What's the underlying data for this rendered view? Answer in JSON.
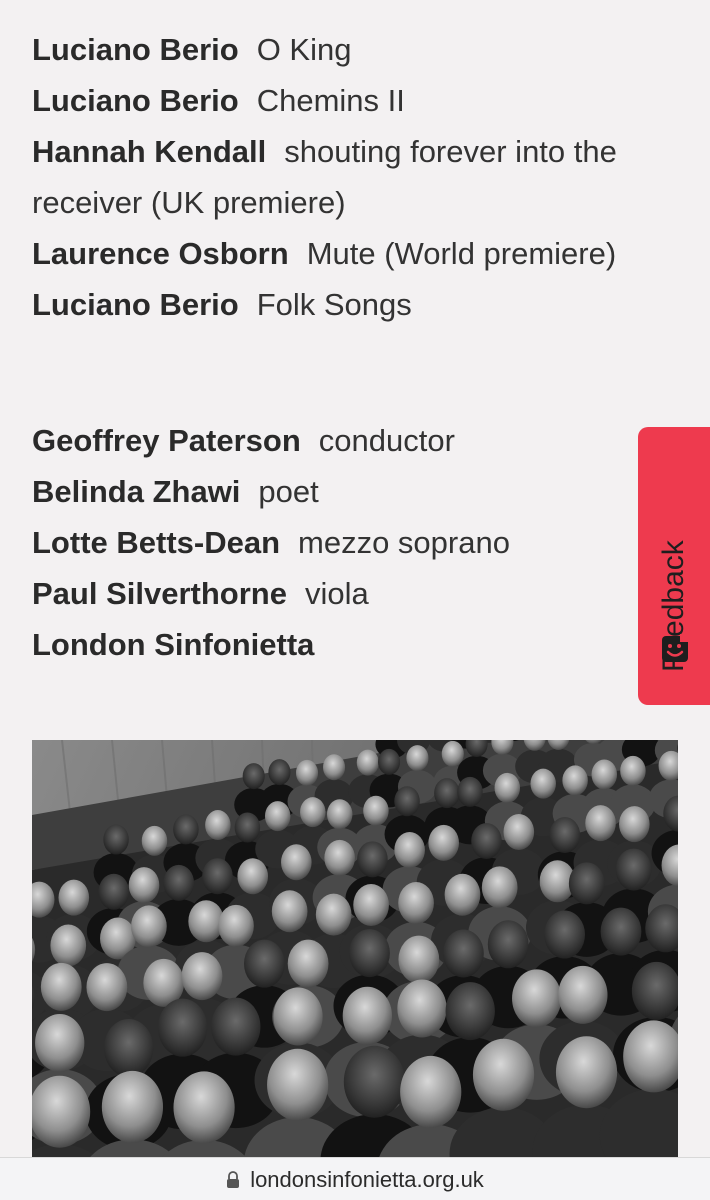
{
  "program": [
    {
      "composer": "Luciano Berio",
      "work": "O King"
    },
    {
      "composer": "Luciano Berio",
      "work": "Chemins II"
    },
    {
      "composer": "Hannah Kendall",
      "work": "shouting forever into the"
    },
    {
      "composer": "",
      "work": "receiver (UK premiere)"
    },
    {
      "composer": "Laurence Osborn",
      "work": "Mute (World premiere)"
    },
    {
      "composer": "Luciano Berio",
      "work": "Folk Songs"
    }
  ],
  "performers": [
    {
      "name": "Geoffrey Paterson",
      "role": "conductor"
    },
    {
      "name": "Belinda Zhawi",
      "role": "poet"
    },
    {
      "name": "Lotte Betts-Dean",
      "role": "mezzo soprano"
    },
    {
      "name": "Paul Silverthorne",
      "role": "viola"
    },
    {
      "name": "London Sinfonietta",
      "role": ""
    }
  ],
  "feedback": {
    "label": "Feedback",
    "icon": "smiley-face-icon",
    "color": "#ee3a4e"
  },
  "photo": {
    "icon": "audience-photo"
  },
  "browser": {
    "url": "londonsinfonietta.org.uk",
    "icon": "lock-icon"
  }
}
